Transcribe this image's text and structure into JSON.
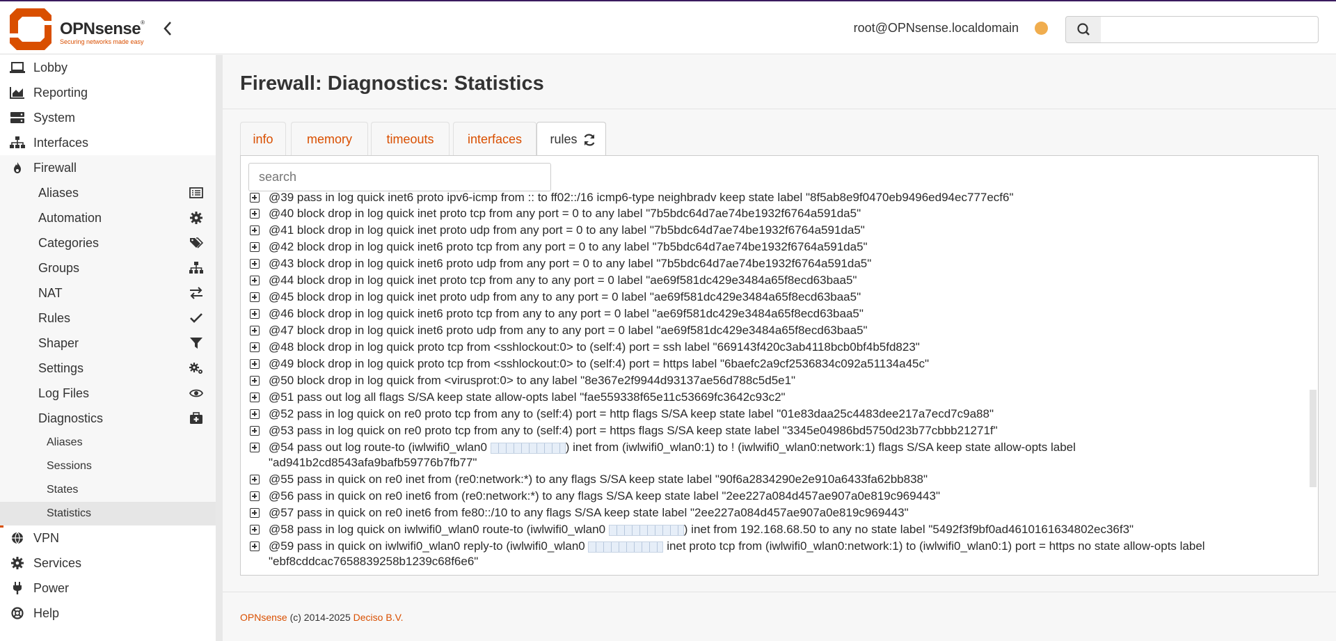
{
  "header": {
    "brand": "OPNsense",
    "registered": "®",
    "tagline": "Securing networks made easy",
    "user": "root@OPNsense.localdomain",
    "search_placeholder": ""
  },
  "sidebar": {
    "items": [
      {
        "label": "Lobby",
        "icon": "laptop-icon"
      },
      {
        "label": "Reporting",
        "icon": "chart-area-icon"
      },
      {
        "label": "System",
        "icon": "server-icon"
      },
      {
        "label": "Interfaces",
        "icon": "sitemap-icon"
      },
      {
        "label": "Firewall",
        "icon": "fire-icon"
      }
    ],
    "firewall_sub": [
      {
        "label": "Aliases",
        "icon": "list-icon"
      },
      {
        "label": "Automation",
        "icon": "gear-icon"
      },
      {
        "label": "Categories",
        "icon": "tags-icon"
      },
      {
        "label": "Groups",
        "icon": "sitemap-icon"
      },
      {
        "label": "NAT",
        "icon": "exchange-icon"
      },
      {
        "label": "Rules",
        "icon": "check-icon"
      },
      {
        "label": "Shaper",
        "icon": "filter-icon"
      },
      {
        "label": "Settings",
        "icon": "gears-icon"
      },
      {
        "label": "Log Files",
        "icon": "eye-icon"
      },
      {
        "label": "Diagnostics",
        "icon": "medkit-icon"
      }
    ],
    "diagnostics_sub": [
      "Aliases",
      "Sessions",
      "States",
      "Statistics"
    ],
    "bottom_items": [
      {
        "label": "VPN",
        "icon": "globe-icon"
      },
      {
        "label": "Services",
        "icon": "gear-icon"
      },
      {
        "label": "Power",
        "icon": "plug-icon"
      },
      {
        "label": "Help",
        "icon": "lifebuoy-icon"
      }
    ]
  },
  "main": {
    "title": "Firewall: Diagnostics: Statistics",
    "tabs": [
      "info",
      "memory",
      "timeouts",
      "interfaces",
      "rules"
    ],
    "active_tab": "rules",
    "search_placeholder": "search",
    "rules": [
      {
        "text": "@39 pass in log quick inet6 proto ipv6-icmp from :: to ff02::/16 icmp6-type neighbradv keep state label \"8f5ab8e9f0470eb9496ed94ec777ecf6\""
      },
      {
        "text": "@40 block drop in log quick inet proto tcp from any port = 0 to any label \"7b5bdc64d7ae74be1932f6764a591da5\""
      },
      {
        "text": "@41 block drop in log quick inet proto udp from any port = 0 to any label \"7b5bdc64d7ae74be1932f6764a591da5\""
      },
      {
        "text": "@42 block drop in log quick inet6 proto tcp from any port = 0 to any label \"7b5bdc64d7ae74be1932f6764a591da5\""
      },
      {
        "text": "@43 block drop in log quick inet6 proto udp from any port = 0 to any label \"7b5bdc64d7ae74be1932f6764a591da5\""
      },
      {
        "text": "@44 block drop in log quick inet proto tcp from any to any port = 0 label \"ae69f581dc429e3484a65f8ecd63baa5\""
      },
      {
        "text": "@45 block drop in log quick inet proto udp from any to any port = 0 label \"ae69f581dc429e3484a65f8ecd63baa5\""
      },
      {
        "text": "@46 block drop in log quick inet6 proto tcp from any to any port = 0 label \"ae69f581dc429e3484a65f8ecd63baa5\""
      },
      {
        "text": "@47 block drop in log quick inet6 proto udp from any to any port = 0 label \"ae69f581dc429e3484a65f8ecd63baa5\""
      },
      {
        "text": "@48 block drop in log quick proto tcp from <sshlockout:0> to (self:4) port = ssh label \"669143f420c3ab4118bcb0bf4b5fd823\""
      },
      {
        "text": "@49 block drop in log quick proto tcp from <sshlockout:0> to (self:4) port = https label \"6baefc2a9cf2536834c092a51134a45c\""
      },
      {
        "text": "@50 block drop in log quick from <virusprot:0> to any label \"8e367e2f9944d93137ae56d788c5d5e1\""
      },
      {
        "text": "@51 pass out log all flags S/SA keep state allow-opts label \"fae559338f65e11c53669fc3642c93c2\""
      },
      {
        "text": "@52 pass in log quick on re0 proto tcp from any to (self:4) port = http flags S/SA keep state label \"01e83daa25c4483dee217a7ecd7c9a88\""
      },
      {
        "text": "@53 pass in log quick on re0 proto tcp from any to (self:4) port = https flags S/SA keep state label \"3345e04986bd5750d23b77cbbb21271f\""
      },
      {
        "pre": "@54 pass out log route-to (iwlwifi0_wlan0 ",
        "post": ") inet from (iwlwifi0_wlan0:1) to ! (iwlwifi0_wlan0:network:1) flags S/SA keep state allow-opts label",
        "line2": "\"ad941b2cd8543afa9bafb59776b7fb77\""
      },
      {
        "text": "@55 pass in quick on re0 inet from (re0:network:*) to any flags S/SA keep state label \"90f6a2834290e2e910a6433fa62bb838\""
      },
      {
        "text": "@56 pass in quick on re0 inet6 from (re0:network:*) to any flags S/SA keep state label \"2ee227a084d457ae907a0e819c969443\""
      },
      {
        "text": "@57 pass in quick on re0 inet6 from fe80::/10 to any flags S/SA keep state label \"2ee227a084d457ae907a0e819c969443\""
      },
      {
        "pre": "@58 pass in log quick on iwlwifi0_wlan0 route-to (iwlwifi0_wlan0 ",
        "post": ") inet from 192.168.68.50 to any no state label \"5492f3f9bf0ad4610161634802ec36f3\""
      },
      {
        "pre": "@59 pass in quick on iwlwifi0_wlan0 reply-to (iwlwifi0_wlan0 ",
        "post": " inet proto tcp from (iwlwifi0_wlan0:network:1) to (iwlwifi0_wlan0:1) port = https no state allow-opts label",
        "line2": "\"ebf8cddcac7658839258b1239c68f6e6\""
      }
    ]
  },
  "footer": {
    "brand_link": "OPNsense",
    "copyright": " (c) 2014-2025 ",
    "company_link": "Deciso B.V."
  }
}
